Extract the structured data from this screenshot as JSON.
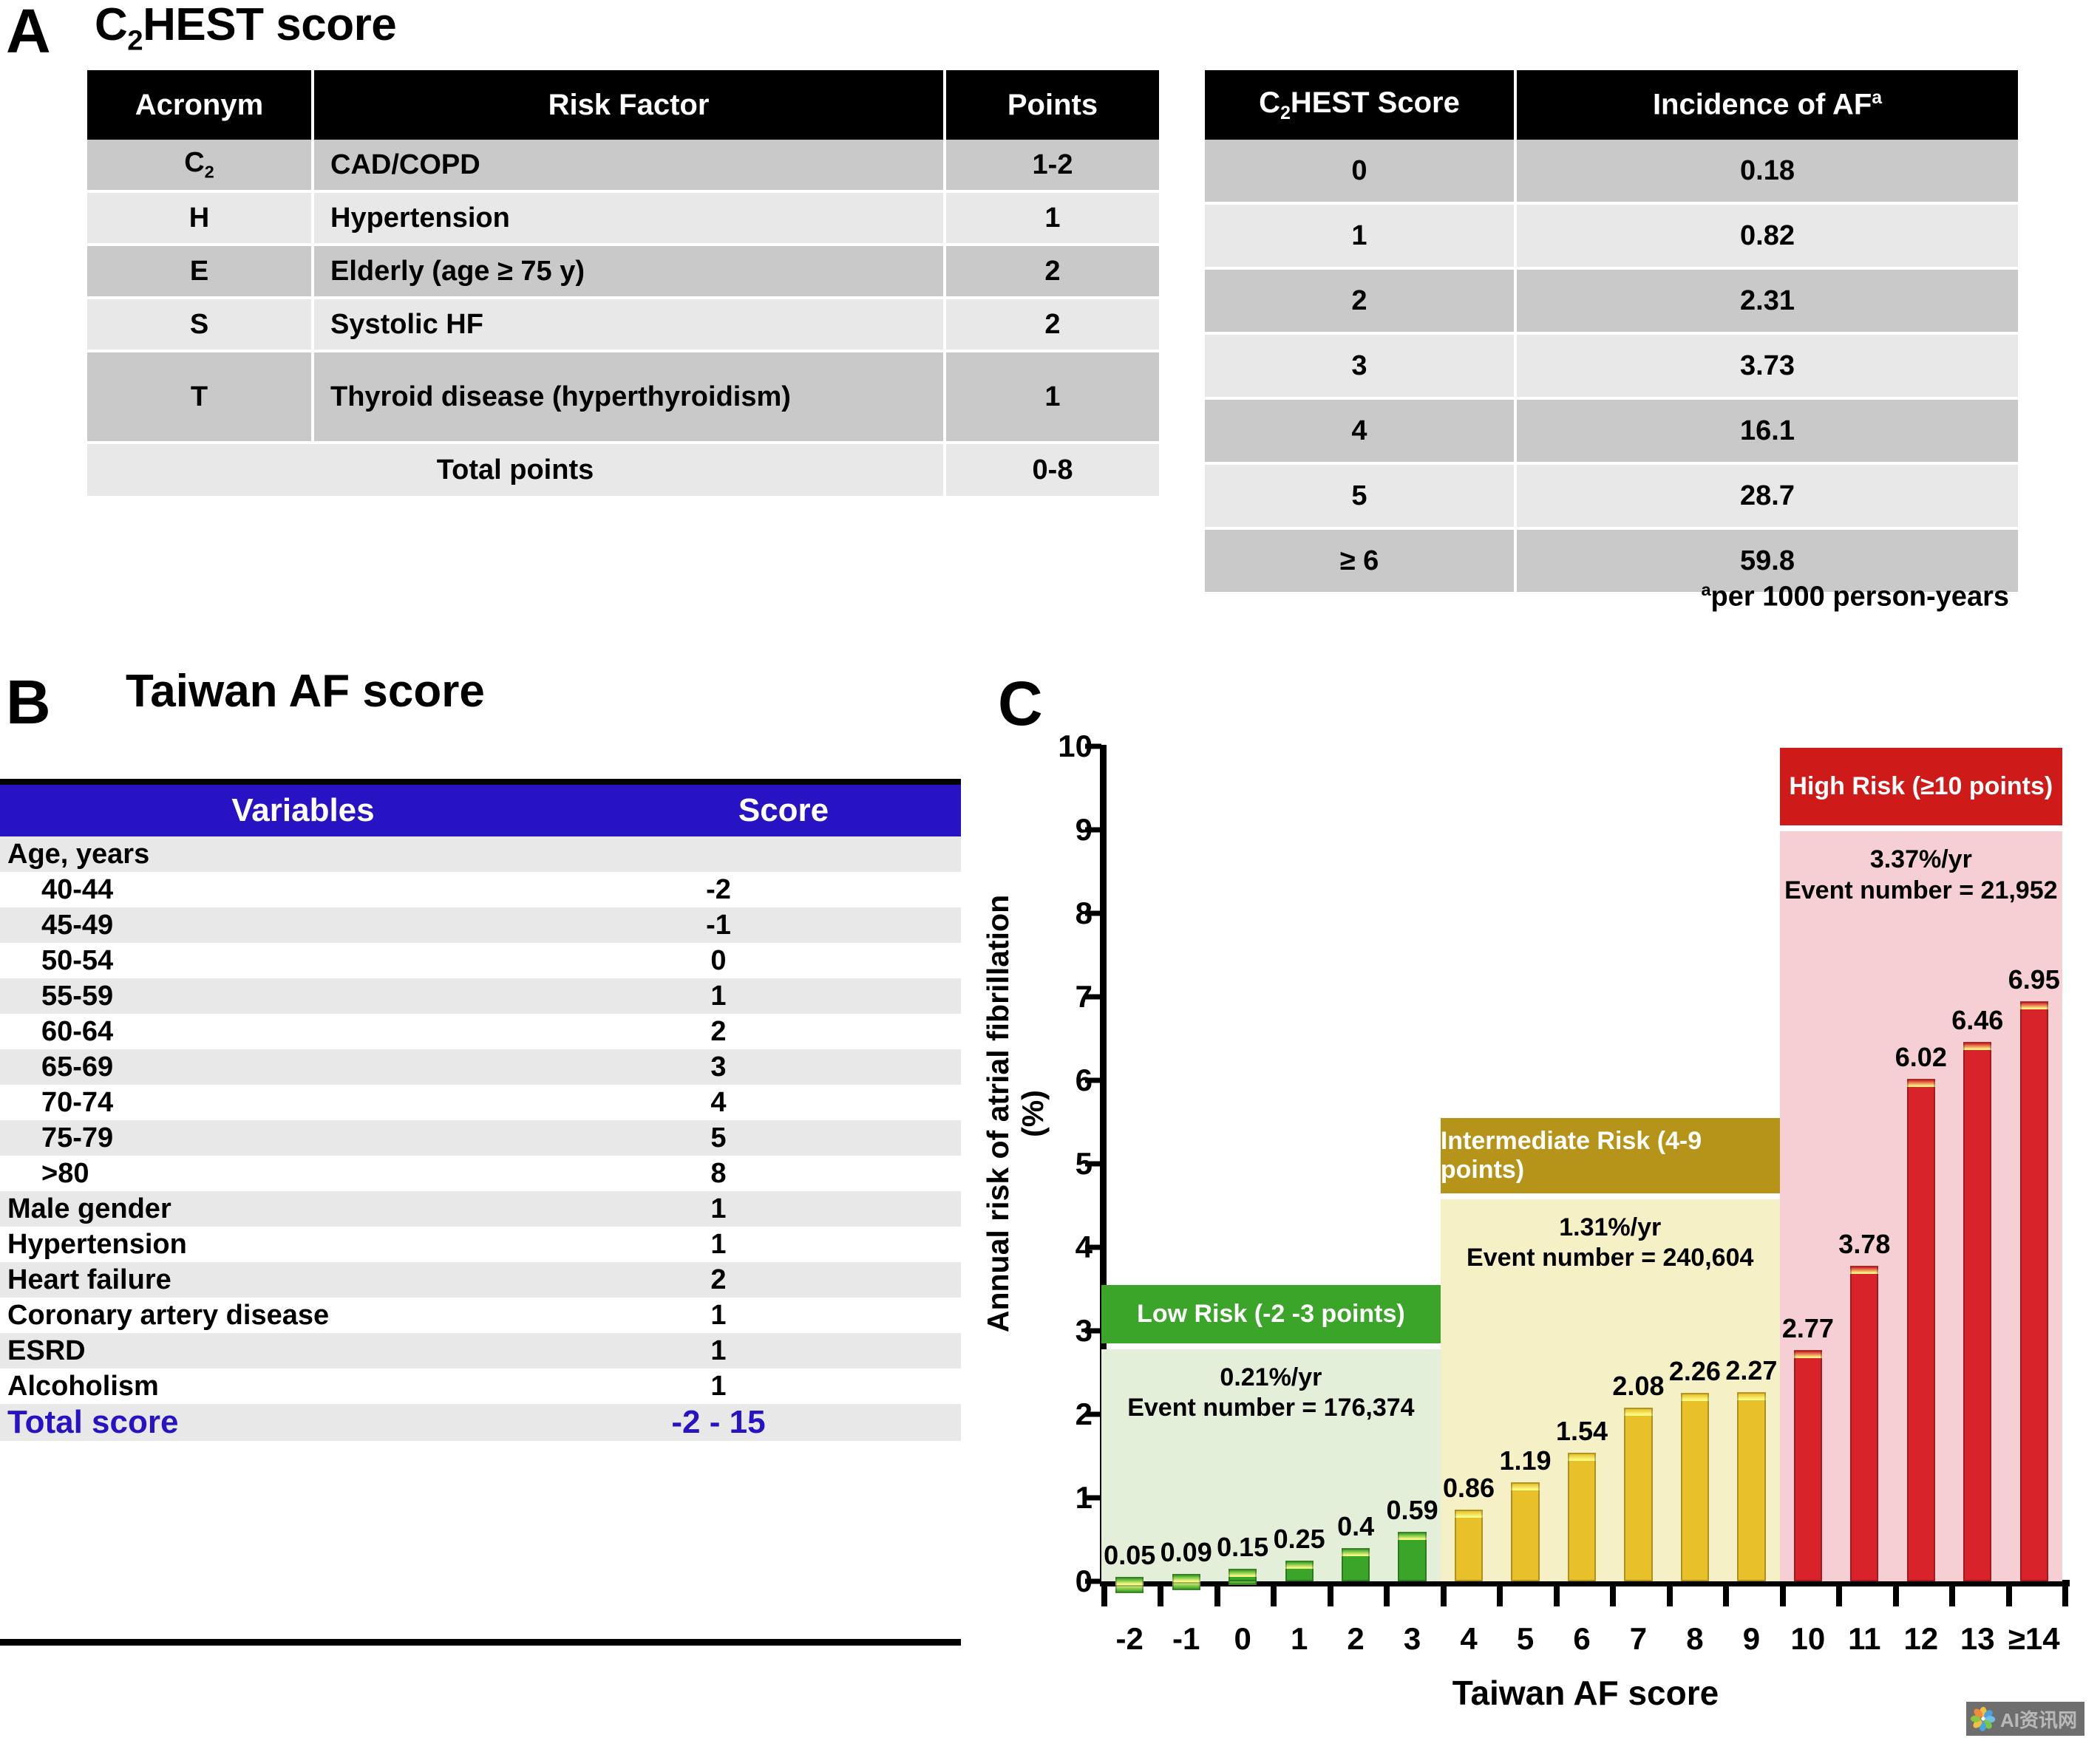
{
  "panelA": {
    "letter": "A",
    "title_prefix": "C",
    "title_sub": "2",
    "title_rest": "HEST score",
    "left_table": {
      "headers": [
        "Acronym",
        "Risk Factor",
        "Points"
      ],
      "rows": [
        {
          "acronym": "C",
          "acronym_sub": "2",
          "risk_factor": "CAD/COPD",
          "points": "1-2"
        },
        {
          "acronym": "H",
          "acronym_sub": "",
          "risk_factor": "Hypertension",
          "points": "1"
        },
        {
          "acronym": "E",
          "acronym_sub": "",
          "risk_factor": "Elderly (age ≥ 75 y)",
          "points": "2"
        },
        {
          "acronym": "S",
          "acronym_sub": "",
          "risk_factor": "Systolic HF",
          "points": "2"
        },
        {
          "acronym": "T",
          "acronym_sub": "",
          "risk_factor": "Thyroid disease (hyperthyroidism)",
          "points": "1"
        }
      ],
      "total_label": "Total points",
      "total_points": "0-8"
    },
    "right_table": {
      "header_score_prefix": "C",
      "header_score_sub": "2",
      "header_score_rest": "HEST Score",
      "header_incidence": "Incidence of AF",
      "header_incidence_sup": "a",
      "rows": [
        {
          "score": "0",
          "incidence": "0.18"
        },
        {
          "score": "1",
          "incidence": "0.82"
        },
        {
          "score": "2",
          "incidence": "2.31"
        },
        {
          "score": "3",
          "incidence": "3.73"
        },
        {
          "score": "4",
          "incidence": "16.1"
        },
        {
          "score": "5",
          "incidence": "28.7"
        },
        {
          "score": "≥ 6",
          "incidence": "59.8"
        }
      ],
      "footnote_sup": "a",
      "footnote": "per 1000 person-years"
    }
  },
  "panelB": {
    "letter": "B",
    "title": "Taiwan AF score",
    "headers": [
      "Variables",
      "Score"
    ],
    "rows": [
      {
        "variable": "Age, years",
        "score": "",
        "indent": false,
        "shade": true
      },
      {
        "variable": "40-44",
        "score": "-2",
        "indent": true,
        "shade": false
      },
      {
        "variable": "45-49",
        "score": "-1",
        "indent": true,
        "shade": true
      },
      {
        "variable": "50-54",
        "score": "0",
        "indent": true,
        "shade": false
      },
      {
        "variable": "55-59",
        "score": "1",
        "indent": true,
        "shade": true
      },
      {
        "variable": "60-64",
        "score": "2",
        "indent": true,
        "shade": false
      },
      {
        "variable": "65-69",
        "score": "3",
        "indent": true,
        "shade": true
      },
      {
        "variable": "70-74",
        "score": "4",
        "indent": true,
        "shade": false
      },
      {
        "variable": "75-79",
        "score": "5",
        "indent": true,
        "shade": true
      },
      {
        "variable": "≥80",
        "score": "8",
        "indent": true,
        "shade": false
      },
      {
        "variable": "Male gender",
        "score": "1",
        "indent": false,
        "shade": true
      },
      {
        "variable": "Hypertension",
        "score": "1",
        "indent": false,
        "shade": false
      },
      {
        "variable": "Heart failure",
        "score": "2",
        "indent": false,
        "shade": true
      },
      {
        "variable": "Coronary artery disease",
        "score": "1",
        "indent": false,
        "shade": false
      },
      {
        "variable": "ESRD",
        "score": "1",
        "indent": false,
        "shade": true
      },
      {
        "variable": "Alcoholism",
        "score": "1",
        "indent": false,
        "shade": false
      }
    ],
    "total_label": "Total score",
    "total_value": "-2 - 15",
    "header_color": "#2713c4",
    "total_color": "#2713c4"
  },
  "panelC": {
    "letter": "C",
    "watermark_text": "AI资讯网"
  },
  "chart_data": {
    "type": "bar",
    "title": "",
    "xlabel": "Taiwan AF score",
    "ylabel": "Annual risk of atrial fibrillation (%)",
    "ylim": [
      0,
      10
    ],
    "yticks": [
      0,
      1,
      2,
      3,
      4,
      5,
      6,
      7,
      8,
      9,
      10
    ],
    "grid": false,
    "legend": "none",
    "categories": [
      "-2",
      "-1",
      "0",
      "1",
      "2",
      "3",
      "4",
      "5",
      "6",
      "7",
      "8",
      "9",
      "10",
      "11",
      "12",
      "13",
      "≥14"
    ],
    "values": [
      0.05,
      0.09,
      0.15,
      0.25,
      0.4,
      0.59,
      0.86,
      1.19,
      1.54,
      2.08,
      2.26,
      2.27,
      2.77,
      3.78,
      6.02,
      6.46,
      6.95
    ],
    "value_labels": [
      "0.05",
      "0.09",
      "0.15",
      "0.25",
      "0.4",
      "0.59",
      "0.86",
      "1.19",
      "1.54",
      "2.08",
      "2.26",
      "2.27",
      "2.77",
      "3.78",
      "6.02",
      "6.46",
      "6.95"
    ],
    "bar_colors": [
      "#3aa528",
      "#3aa528",
      "#3aa528",
      "#3aa528",
      "#3aa528",
      "#3aa528",
      "#e8c02a",
      "#e8c02a",
      "#e8c02a",
      "#e8c02a",
      "#e8c02a",
      "#e8c02a",
      "#d8232a",
      "#d8232a",
      "#d8232a",
      "#d8232a",
      "#d8232a"
    ],
    "risk_bands": [
      {
        "name": "low",
        "label": "Low Risk (-2 -3 points)",
        "rate": "0.21%/yr",
        "events": "Event number = 176,374",
        "header_color": "#3aa528",
        "body_color": "#e4efd9",
        "start_index": 0,
        "end_index": 5,
        "top_value": 3.55,
        "header_bottom_value": 2.85
      },
      {
        "name": "intermediate",
        "label": "Intermediate Risk (4-9 points)",
        "rate": "1.31%/yr",
        "events": "Event number = 240,604",
        "header_color": "#b59419",
        "body_color": "#f6f0c6",
        "start_index": 6,
        "end_index": 11,
        "top_value": 5.55,
        "header_bottom_value": 4.65
      },
      {
        "name": "high",
        "label": "High Risk (≥10 points)",
        "rate": "3.37%/yr",
        "events": "Event number = 21,952",
        "header_color": "#cf1a1a",
        "body_color": "#f6cfd4",
        "start_index": 12,
        "end_index": 16,
        "top_value": 9.98,
        "header_bottom_value": 9.05
      }
    ]
  }
}
